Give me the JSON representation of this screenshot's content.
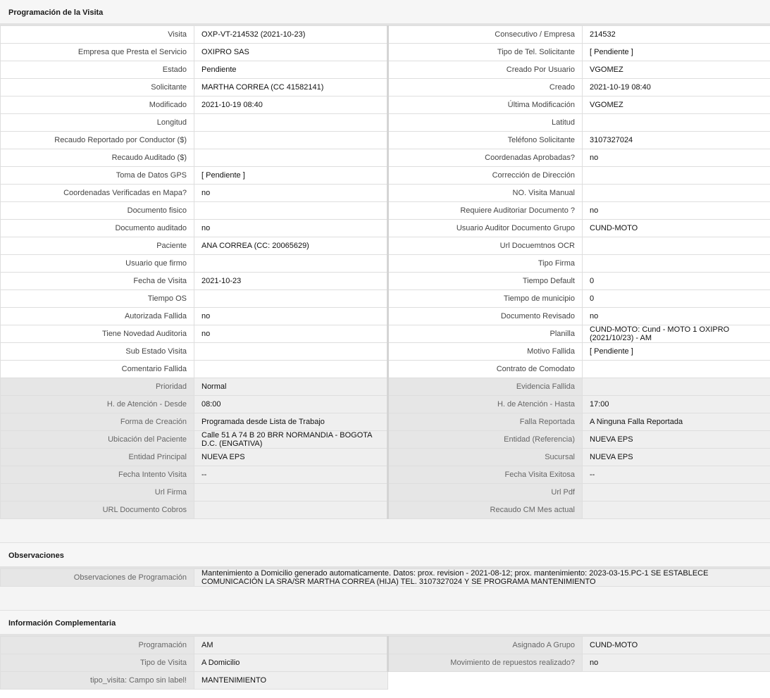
{
  "program": {
    "title": "Programación de la Visita",
    "rows": [
      {
        "l1": "Visita",
        "v1": "OXP-VT-214532 (2021-10-23)",
        "l2": "Consecutivo / Empresa",
        "v2": "214532"
      },
      {
        "l1": "Empresa que Presta el Servicio",
        "v1": "OXIPRO SAS",
        "l2": "Tipo de Tel. Solicitante",
        "v2": "[ Pendiente ]"
      },
      {
        "l1": "Estado",
        "v1": "Pendiente",
        "l2": "Creado Por Usuario",
        "v2": "VGOMEZ"
      },
      {
        "l1": "Solicitante",
        "v1": "MARTHA CORREA (CC 41582141)",
        "l2": "Creado",
        "v2": "2021-10-19 08:40"
      },
      {
        "l1": "Modificado",
        "v1": "2021-10-19 08:40",
        "l2": "Última Modificación",
        "v2": " VGOMEZ"
      },
      {
        "l1": "Longitud",
        "v1": "",
        "l2": "Latitud",
        "v2": ""
      },
      {
        "l1": "Recaudo Reportado por Conductor ($)",
        "v1": "",
        "l2": "Teléfono Solicitante",
        "v2": "3107327024"
      },
      {
        "l1": "Recaudo Auditado ($)",
        "v1": "",
        "l2": "Coordenadas Aprobadas?",
        "v2": " no"
      },
      {
        "l1": "Toma de Datos GPS",
        "v1": "[ Pendiente ]",
        "l2": "Corrección de Dirección",
        "v2": ""
      },
      {
        "l1": "Coordenadas Verificadas en Mapa?",
        "v1": " no",
        "l2": "NO. Visita Manual",
        "v2": ""
      },
      {
        "l1": "Documento fisico",
        "v1": "",
        "l2": "Requiere Auditoriar Documento ?",
        "v2": " no"
      },
      {
        "l1": "Documento auditado",
        "v1": " no",
        "l2": "Usuario Auditor Documento Grupo",
        "v2": "CUND-MOTO"
      },
      {
        "l1": "Paciente",
        "v1": "ANA CORREA (CC: 20065629)",
        "l2": "Url Docuemtnos OCR",
        "v2": ""
      },
      {
        "l1": "Usuario que firmo",
        "v1": "",
        "l2": "Tipo Firma",
        "v2": ""
      },
      {
        "l1": "Fecha de Visita",
        "v1": " 2021-10-23",
        "l2": "Tiempo Default",
        "v2": "0"
      },
      {
        "l1": "Tiempo OS",
        "v1": "",
        "l2": "Tiempo de municipio",
        "v2": "0"
      },
      {
        "l1": "Autorizada Fallida",
        "v1": " no",
        "l2": "Documento Revisado",
        "v2": " no"
      },
      {
        "l1": "Tiene Novedad Auditoria",
        "v1": " no",
        "l2": "Planilla",
        "v2": "CUND-MOTO: Cund - MOTO 1 OXIPRO (2021/10/23) - AM"
      },
      {
        "l1": "Sub Estado Visita",
        "v1": "",
        "l2": "Motivo Fallida",
        "v2": "[ Pendiente ]"
      },
      {
        "l1": "Comentario Fallida",
        "v1": "",
        "l2": "Contrato de Comodato",
        "v2": ""
      }
    ],
    "gray_rows": [
      {
        "l1": "Prioridad",
        "v1": "Normal",
        "l2": "Evidencia Fallida",
        "v2": ""
      },
      {
        "l1": "H. de Atención - Desde",
        "v1": "08:00",
        "l2": "H. de Atención - Hasta",
        "v2": "17:00"
      },
      {
        "l1": "Forma de Creación",
        "v1": "Programada desde Lista de Trabajo",
        "l2": "Falla Reportada",
        "v2": "A Ninguna Falla Reportada"
      },
      {
        "l1": "Ubicación del Paciente",
        "v1": "Calle 51 A 74 B 20 BRR NORMANDIA - BOGOTA D.C. (ENGATIVA)",
        "l2": "Entidad (Referencia)",
        "v2": "NUEVA EPS"
      },
      {
        "l1": "Entidad Principal",
        "v1": "NUEVA EPS",
        "l2": "Sucursal",
        "v2": "NUEVA EPS"
      },
      {
        "l1": "Fecha Intento Visita",
        "v1": " --",
        "l2": "Fecha Visita Exitosa",
        "v2": " --"
      },
      {
        "l1": "Url Firma",
        "v1": "",
        "l2": "Url Pdf",
        "v2": ""
      },
      {
        "l1": "URL Documento Cobros",
        "v1": "",
        "l2": "Recaudo CM Mes actual",
        "v2": ""
      }
    ]
  },
  "observations": {
    "title": "Observaciones",
    "label": "Observaciones de Programación",
    "value": "  Mantenimiento a Domicilio generado automaticamente. Datos: prox. revision - 2021-08-12; prox. mantenimiento: 2023-03-15.PC-1 SE ESTABLECE COMUNICACIÓN LA SRA/SR MARTHA CORREA (HIJA) TEL. 3107327024 Y SE PROGRAMA MANTENIMIENTO"
  },
  "complementary": {
    "title": "Información Complementaria",
    "rows": [
      {
        "l1": "Programación",
        "v1": "AM",
        "l2": "Asignado A Grupo",
        "v2": "CUND-MOTO"
      },
      {
        "l1": "Tipo de Visita",
        "v1": "A Domicilio",
        "l2": "Movimiento de repuestos realizado?",
        "v2": " no"
      },
      {
        "l1": "tipo_visita: Campo sin label!",
        "v1": "MANTENIMIENTO",
        "l2": "",
        "v2": ""
      }
    ]
  }
}
